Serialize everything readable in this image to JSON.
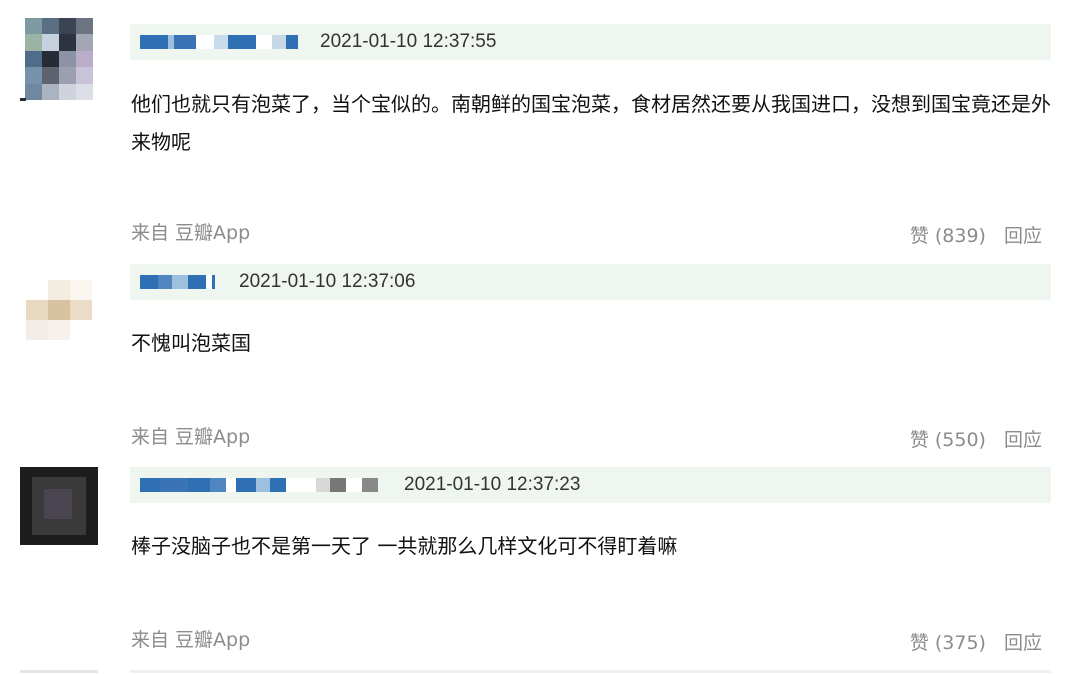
{
  "comments": [
    {
      "timestamp": "2021-01-10 12:37:55",
      "text": "他们也就只有泡菜了，当个宝似的。南朝鲜的国宝泡菜，食材居然还要从我国进口，没想到国宝竟还是外来物呢",
      "source": "来自 豆瓣App",
      "like_label": "赞 (839)",
      "reply_label": "回应"
    },
    {
      "timestamp": "2021-01-10 12:37:06",
      "text": "不愧叫泡菜国",
      "source": "来自 豆瓣App",
      "like_label": "赞 (550)",
      "reply_label": "回应"
    },
    {
      "timestamp": "2021-01-10 12:37:23",
      "text": "棒子没脑子也不是第一天了 一共就那么几样文化可不得盯着嘛",
      "source": "来自 豆瓣App",
      "like_label": "赞 (375)",
      "reply_label": "回应"
    }
  ],
  "colors": {
    "meta_bar_bg": "#eef6ef",
    "redaction_blue": "#2f6fb3",
    "muted_text": "#8c8c8c"
  },
  "icons": [
    "pixelated-avatar-icon"
  ]
}
